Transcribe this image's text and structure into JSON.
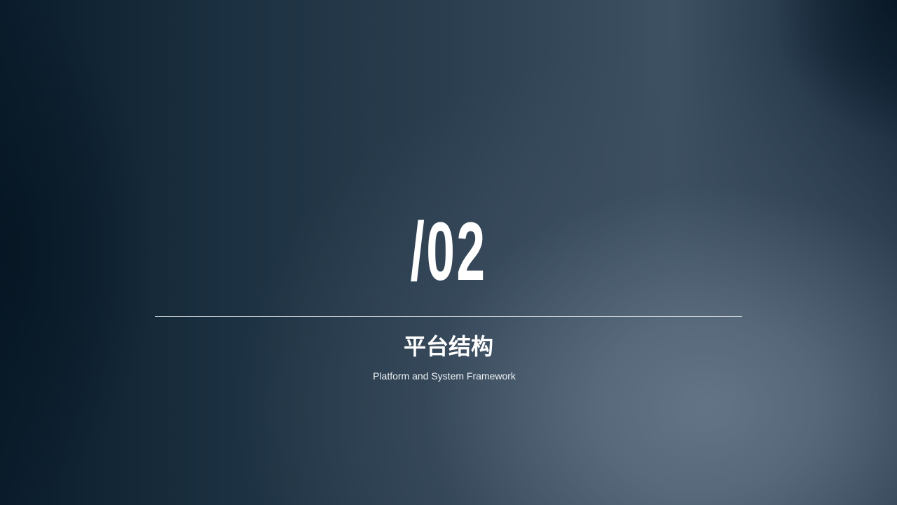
{
  "slide": {
    "section_number": "/02",
    "title": "平台结构",
    "subtitle": "Platform and System Framework"
  },
  "colors": {
    "text": "#ffffff",
    "background_dark": "#0a1c2b",
    "background_light": "#5b6d7e",
    "divider": "#e9eef2"
  }
}
